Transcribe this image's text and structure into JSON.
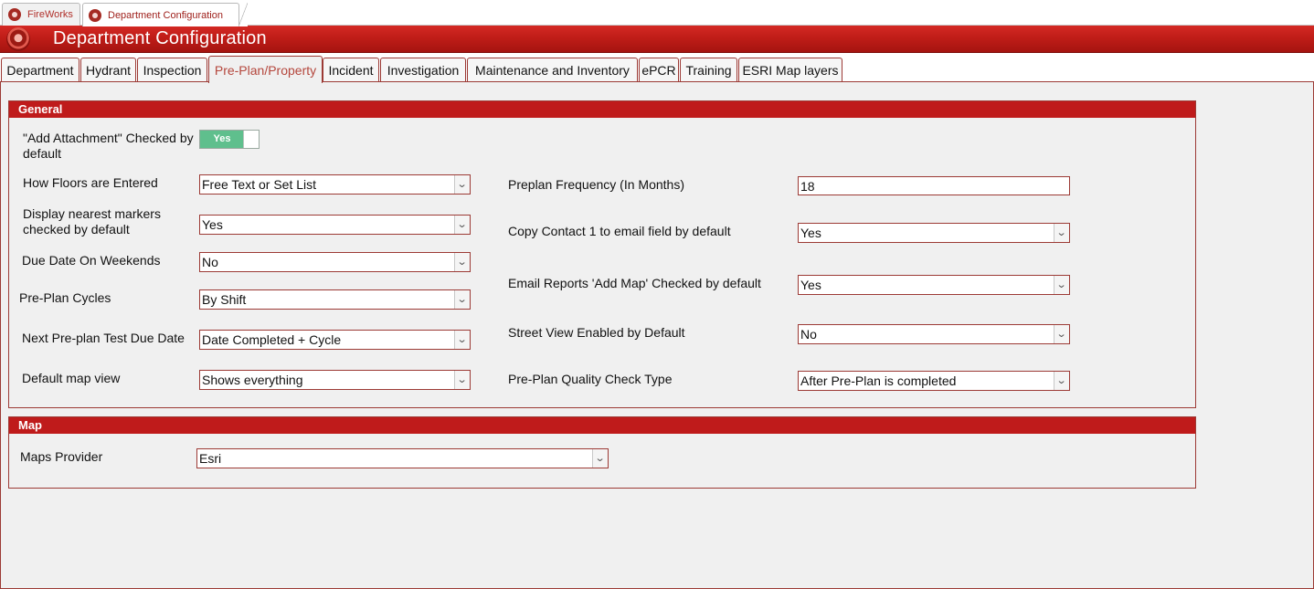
{
  "doc_tabs": [
    {
      "label": "FireWorks",
      "icon": "fireworks-logo-icon",
      "active": false
    },
    {
      "label": "Department Configuration",
      "icon": "fireworks-logo-icon",
      "active": true
    }
  ],
  "banner": {
    "title": "Department Configuration",
    "icon": "fireworks-logo-icon"
  },
  "tabs": [
    {
      "label": "Department"
    },
    {
      "label": "Hydrant"
    },
    {
      "label": "Inspection"
    },
    {
      "label": "Pre-Plan/Property",
      "active": true
    },
    {
      "label": "Incident"
    },
    {
      "label": "Investigation"
    },
    {
      "label": "Maintenance and Inventory"
    },
    {
      "label": "ePCR"
    },
    {
      "label": "Training"
    },
    {
      "label": "ESRI Map layers"
    }
  ],
  "general": {
    "title": "General",
    "add_attachment": {
      "label": "\"Add Attachment\" Checked by default",
      "value": "Yes"
    },
    "how_floors": {
      "label": "How Floors are Entered",
      "value": "Free Text or Set List"
    },
    "display_markers": {
      "label": "Display nearest markers checked by default",
      "value": "Yes"
    },
    "due_date_weekends": {
      "label": "Due Date On Weekends",
      "value": "No"
    },
    "preplan_cycles": {
      "label": "Pre-Plan Cycles",
      "value": "By Shift"
    },
    "next_test_due": {
      "label": "Next Pre-plan Test Due Date",
      "value": "Date Completed + Cycle"
    },
    "default_map_view": {
      "label": "Default map view",
      "value": "Shows everything"
    },
    "preplan_frequency": {
      "label": "Preplan Frequency (In Months)",
      "value": "18"
    },
    "copy_contact": {
      "label": "Copy Contact 1 to email field by default",
      "value": "Yes"
    },
    "email_add_map": {
      "label": "Email Reports 'Add Map' Checked by default",
      "value": "Yes"
    },
    "street_view": {
      "label": "Street View Enabled by Default",
      "value": "No"
    },
    "quality_check": {
      "label": "Pre-Plan Quality Check Type",
      "value": "After Pre-Plan is completed"
    }
  },
  "map": {
    "title": "Map",
    "maps_provider": {
      "label": "Maps Provider",
      "value": "Esri"
    }
  },
  "colors": {
    "accent": "#bf1b1b",
    "toggle_on": "#5fbf8d",
    "border": "#9c3a35",
    "panel": "#f0f0f0"
  }
}
